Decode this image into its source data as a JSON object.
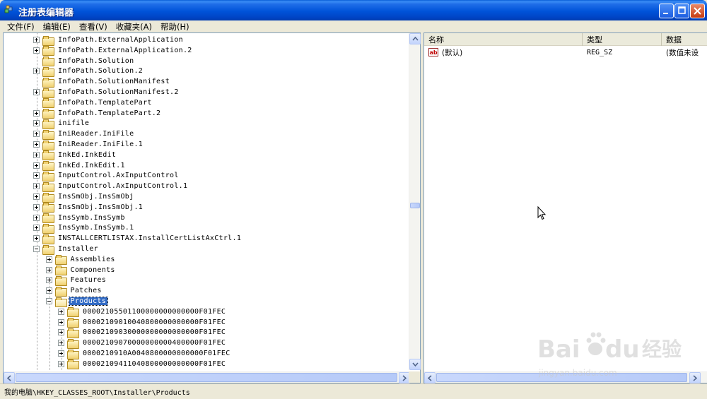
{
  "window": {
    "title": "注册表编辑器"
  },
  "menu": [
    {
      "label": "文件(F)"
    },
    {
      "label": "编辑(E)"
    },
    {
      "label": "查看(V)"
    },
    {
      "label": "收藏夹(A)"
    },
    {
      "label": "帮助(H)"
    }
  ],
  "tree": {
    "nodes": [
      {
        "label": "InfoPath.ExternalApplication",
        "level": 0,
        "expander": "plus"
      },
      {
        "label": "InfoPath.ExternalApplication.2",
        "level": 0,
        "expander": "plus"
      },
      {
        "label": "InfoPath.Solution",
        "level": 0,
        "expander": "none"
      },
      {
        "label": "InfoPath.Solution.2",
        "level": 0,
        "expander": "plus"
      },
      {
        "label": "InfoPath.SolutionManifest",
        "level": 0,
        "expander": "none"
      },
      {
        "label": "InfoPath.SolutionManifest.2",
        "level": 0,
        "expander": "plus"
      },
      {
        "label": "InfoPath.TemplatePart",
        "level": 0,
        "expander": "none"
      },
      {
        "label": "InfoPath.TemplatePart.2",
        "level": 0,
        "expander": "plus"
      },
      {
        "label": "inifile",
        "level": 0,
        "expander": "plus"
      },
      {
        "label": "IniReader.IniFile",
        "level": 0,
        "expander": "plus"
      },
      {
        "label": "IniReader.IniFile.1",
        "level": 0,
        "expander": "plus"
      },
      {
        "label": "InkEd.InkEdit",
        "level": 0,
        "expander": "plus"
      },
      {
        "label": "InkEd.InkEdit.1",
        "level": 0,
        "expander": "plus"
      },
      {
        "label": "InputControl.AxInputControl",
        "level": 0,
        "expander": "plus"
      },
      {
        "label": "InputControl.AxInputControl.1",
        "level": 0,
        "expander": "plus"
      },
      {
        "label": "InsSmObj.InsSmObj",
        "level": 0,
        "expander": "plus"
      },
      {
        "label": "InsSmObj.InsSmObj.1",
        "level": 0,
        "expander": "plus"
      },
      {
        "label": "InsSymb.InsSymb",
        "level": 0,
        "expander": "plus"
      },
      {
        "label": "InsSymb.InsSymb.1",
        "level": 0,
        "expander": "plus"
      },
      {
        "label": "INSTALLCERTLISTAX.InstallCertListAxCtrl.1",
        "level": 0,
        "expander": "plus"
      },
      {
        "label": "Installer",
        "level": 0,
        "expander": "minus"
      },
      {
        "label": "Assemblies",
        "level": 1,
        "expander": "plus"
      },
      {
        "label": "Components",
        "level": 1,
        "expander": "plus"
      },
      {
        "label": "Features",
        "level": 1,
        "expander": "plus"
      },
      {
        "label": "Patches",
        "level": 1,
        "expander": "plus"
      },
      {
        "label": "Products",
        "level": 1,
        "expander": "minus",
        "selected": true,
        "open": true
      },
      {
        "label": "00002105501100000000000000F01FEC",
        "level": 2,
        "expander": "plus"
      },
      {
        "label": "00002109010040800000000000F01FEC",
        "level": 2,
        "expander": "plus"
      },
      {
        "label": "00002109030000000000000000F01FEC",
        "level": 2,
        "expander": "plus"
      },
      {
        "label": "00002109070000000000400000F01FEC",
        "level": 2,
        "expander": "plus"
      },
      {
        "label": "0000210910A0040800000000000F01FEC",
        "level": 2,
        "expander": "plus"
      },
      {
        "label": "00002109411040800000000000F01FEC",
        "level": 2,
        "expander": "plus"
      }
    ]
  },
  "list": {
    "columns": [
      "名称",
      "类型",
      "数据"
    ],
    "rows": [
      {
        "icon": "string-value-icon",
        "name": "(默认)",
        "type": "REG_SZ",
        "data": "(数值未设"
      }
    ]
  },
  "status": {
    "path": "我的电脑\\HKEY_CLASSES_ROOT\\Installer\\Products"
  },
  "watermark": {
    "text": "Bai",
    "text2": "du",
    "cn": "经验",
    "sub": "jingyan.baidu.com"
  }
}
